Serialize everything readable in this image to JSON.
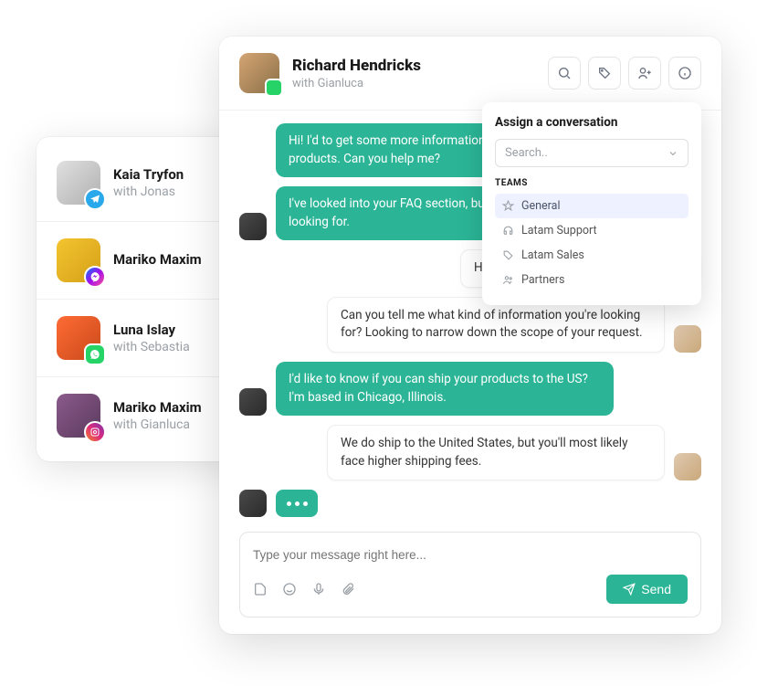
{
  "sidebar": {
    "conversations": [
      {
        "name": "Kaia Tryfon",
        "sub": "with Jonas",
        "channel": "telegram"
      },
      {
        "name": "Mariko Maxim",
        "sub": "",
        "channel": "messenger"
      },
      {
        "name": "Luna Islay",
        "sub": "with Sebastia",
        "channel": "whatsapp"
      },
      {
        "name": "Mariko Maxim",
        "sub": "with Gianluca",
        "channel": "instagram"
      }
    ]
  },
  "chat": {
    "title": "Richard Hendricks",
    "sub": "with Gianluca",
    "channel": "whatsapp",
    "messages": [
      {
        "side": "left",
        "style": "green",
        "text": "Hi! I'd to get some more informations about your products. Can you help me?",
        "avatar": true
      },
      {
        "side": "left",
        "style": "green",
        "text": "I've looked into your FAQ section, but I can't find what I'm looking for.",
        "avatar": true
      },
      {
        "side": "right",
        "style": "white",
        "text": "Hello Luna! Thank you for reaching out.",
        "avatar": false
      },
      {
        "side": "right",
        "style": "white",
        "text": "Can you tell me what kind of information you're looking for? Looking to narrow down the scope of your request.",
        "avatar": true
      },
      {
        "side": "left",
        "style": "green",
        "text": "I'd like to know if you can ship your products to the US? I'm based in Chicago, Illinois.",
        "avatar": true
      },
      {
        "side": "right",
        "style": "white",
        "text": "We do ship to the United States, but you'll most likely face higher shipping fees.",
        "avatar": true
      }
    ],
    "composer": {
      "placeholder": "Type your message right here...",
      "send_label": "Send"
    }
  },
  "assign": {
    "title": "Assign a conversation",
    "search_placeholder": "Search..",
    "section_label": "TEAMS",
    "teams": [
      {
        "label": "General",
        "icon": "star",
        "selected": true
      },
      {
        "label": "Latam Support",
        "icon": "headset",
        "selected": false
      },
      {
        "label": "Latam Sales",
        "icon": "tag",
        "selected": false
      },
      {
        "label": "Partners",
        "icon": "users",
        "selected": false
      }
    ]
  }
}
